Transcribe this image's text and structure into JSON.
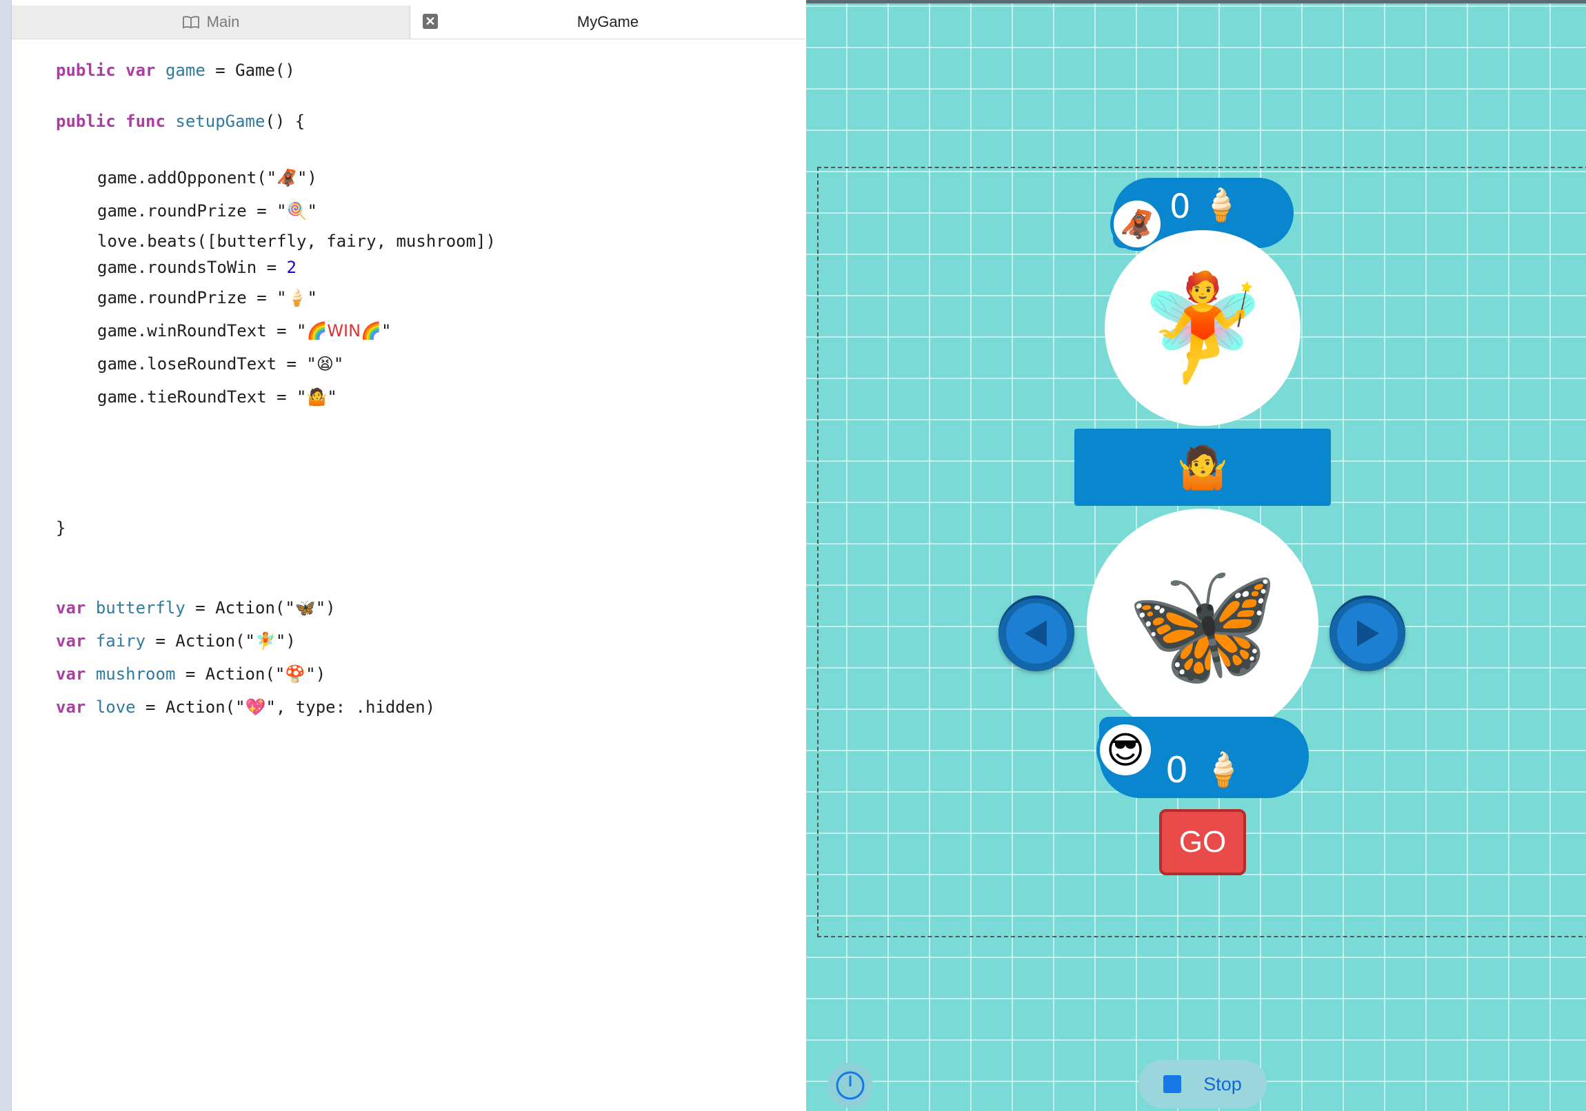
{
  "tabs": {
    "main_label": "Main",
    "game_label": "MyGame",
    "close_glyph": "✕"
  },
  "code": {
    "line1": {
      "kw1": "public",
      "kw2": "var",
      "name": "game",
      "rest": " = Game()"
    },
    "line2": {
      "kw1": "public",
      "kw2": "func",
      "name": "setupGame",
      "rest": "() {"
    },
    "l_addOpponent": {
      "pre": "game.addOpponent(\"",
      "emoji": "🦧",
      "post": "\")"
    },
    "l_roundPrize1": {
      "pre": "game.roundPrize = \"",
      "emoji": "🍭",
      "post": "\""
    },
    "l_beats": {
      "text": "love.beats([butterfly, fairy, mushroom])"
    },
    "l_roundsToWin": {
      "pre": "game.roundsToWin = ",
      "num": "2"
    },
    "l_roundPrize2": {
      "pre": "game.roundPrize = \"",
      "emoji": "🍦",
      "post": "\""
    },
    "l_winText": {
      "pre": "game.winRoundText = \"",
      "emoji1": "🌈",
      "word": "WIN",
      "emoji2": "🌈",
      "post": "\""
    },
    "l_loseText": {
      "pre": "game.loseRoundText = \"",
      "emoji": "😫",
      "post": "\""
    },
    "l_tieText": {
      "pre": "game.tieRoundText = \"",
      "emoji": "🤷",
      "post": "\""
    },
    "close_brace": "}",
    "v_butterfly": {
      "kw": "var",
      "name": "butterfly",
      "pre": " = Action(\"",
      "emoji": "🦋",
      "post": "\")"
    },
    "v_fairy": {
      "kw": "var",
      "name": "fairy",
      "pre": " = Action(\"",
      "emoji": "🧚",
      "post": "\")"
    },
    "v_mushroom": {
      "kw": "var",
      "name": "mushroom",
      "pre": " = Action(\"",
      "emoji": "🍄",
      "post": "\")"
    },
    "v_love": {
      "kw": "var",
      "name": "love",
      "pre": " = Action(\"",
      "emoji": "💖",
      "post": "\", type: .hidden)"
    }
  },
  "game": {
    "opponent_avatar": "🦧",
    "opponent_score": "0",
    "opponent_prize": "🍦",
    "opponent_choice": "🧚",
    "result_text": "🤷",
    "player_choice": "🦋",
    "player_avatar": "😎",
    "player_score": "0",
    "player_prize": "🍦",
    "go_label": "GO"
  },
  "controls": {
    "stop_label": "Stop"
  },
  "colors": {
    "stage": "#7adbd6",
    "accent_blue": "#0a86cf",
    "go_red": "#e94a4a",
    "keyword": "#ad3da4",
    "identifier": "#2e7ba0"
  }
}
